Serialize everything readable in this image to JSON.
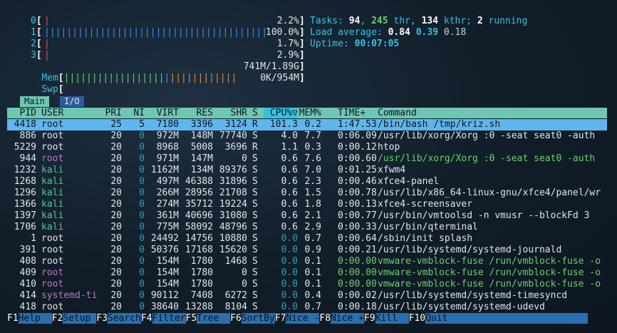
{
  "meters": {
    "cpu": [
      {
        "label": "0",
        "pct": "2.2%",
        "fill": 0.02
      },
      {
        "label": "1",
        "pct": "100.0%",
        "fill": 1.0
      },
      {
        "label": "2",
        "pct": "1.7%",
        "fill": 0.017
      },
      {
        "label": "3",
        "pct": "2.9%",
        "fill": 0.03
      }
    ],
    "mem": {
      "label": "Mem",
      "value": "741M/1.89G",
      "used_fill": 0.4
    },
    "swp": {
      "label": "Swp",
      "value": "0K/954M",
      "fill": 0.0
    }
  },
  "summary": {
    "tasks_label": "Tasks: ",
    "tasks": "94",
    "thr": "245",
    "thr_label": " thr, ",
    "kthr": "134",
    "kthr_label": " kthr; ",
    "running": "2",
    "running_label": " running",
    "load_label": "Load average: ",
    "load1": "0.84",
    "load5": "0.39",
    "load15": "0.18",
    "uptime_label": "Uptime: ",
    "uptime": "00:07:05"
  },
  "tabs": [
    {
      "label": "Main"
    },
    {
      "label": "I/O"
    }
  ],
  "columns": {
    "pid": "PID",
    "user": "USER",
    "pri": "PRI",
    "ni": "NI",
    "virt": "VIRT",
    "res": "RES",
    "shr": "SHR",
    "s": "S",
    "cpu": "CPU%▽",
    "mem": "MEM%",
    "time": "TIME+",
    "cmd": "Command"
  },
  "rows": [
    {
      "pid": "4418",
      "user": "root",
      "pri": "25",
      "ni": "5",
      "virt": "7180",
      "res": "3396",
      "shr": "3124",
      "s": "R",
      "cpu": "101.3",
      "mem": "0.2",
      "time": "1:47.53",
      "cmd": "/bin/bash /tmp/kriz.sh"
    },
    {
      "pid": "886",
      "user": "root",
      "pri": "20",
      "ni": "0",
      "virt": "972M",
      "res": "148M",
      "shr": "77740",
      "s": "S",
      "cpu": "4.0",
      "mem": "7.7",
      "time": "0:06.09",
      "cmd": "/usr/lib/xorg/Xorg :0 -seat seat0 -auth"
    },
    {
      "pid": "5229",
      "user": "root",
      "pri": "20",
      "ni": "0",
      "virt": "8968",
      "res": "5008",
      "shr": "3696",
      "s": "R",
      "cpu": "1.1",
      "mem": "0.3",
      "time": "0:00.12",
      "cmd": "htop"
    },
    {
      "pid": "944",
      "user": "root",
      "pri": "20",
      "ni": "0",
      "virt": "971M",
      "res": "147M",
      "shr": "0",
      "s": "S",
      "cpu": "0.6",
      "mem": "7.6",
      "time": "0:00.60",
      "cmd": "/usr/lib/xorg/Xorg :0 -seat seat0 -auth"
    },
    {
      "pid": "1232",
      "user": "kali",
      "pri": "20",
      "ni": "0",
      "virt": "1162M",
      "res": "134M",
      "shr": "89376",
      "s": "S",
      "cpu": "0.6",
      "mem": "7.0",
      "time": "0:01.25",
      "cmd": "xfwm4"
    },
    {
      "pid": "1268",
      "user": "kali",
      "pri": "20",
      "ni": "0",
      "virt": "497M",
      "res": "46388",
      "shr": "31896",
      "s": "S",
      "cpu": "0.6",
      "mem": "2.3",
      "time": "0:00.46",
      "cmd": "xfce4-panel"
    },
    {
      "pid": "1296",
      "user": "kali",
      "pri": "20",
      "ni": "0",
      "virt": "266M",
      "res": "28956",
      "shr": "21708",
      "s": "S",
      "cpu": "0.6",
      "mem": "1.5",
      "time": "0:00.78",
      "cmd": "/usr/lib/x86_64-linux-gnu/xfce4/panel/wr"
    },
    {
      "pid": "1366",
      "user": "kali",
      "pri": "20",
      "ni": "0",
      "virt": "274M",
      "res": "35712",
      "shr": "19224",
      "s": "S",
      "cpu": "0.6",
      "mem": "1.8",
      "time": "0:00.13",
      "cmd": "xfce4-screensaver"
    },
    {
      "pid": "1397",
      "user": "kali",
      "pri": "20",
      "ni": "0",
      "virt": "361M",
      "res": "40696",
      "shr": "31080",
      "s": "S",
      "cpu": "0.6",
      "mem": "2.1",
      "time": "0:00.77",
      "cmd": "/usr/bin/vmtoolsd -n vmusr --blockFd 3"
    },
    {
      "pid": "1706",
      "user": "kali",
      "pri": "20",
      "ni": "0",
      "virt": "775M",
      "res": "58092",
      "shr": "48796",
      "s": "S",
      "cpu": "0.6",
      "mem": "2.9",
      "time": "0:00.33",
      "cmd": "/usr/bin/qterminal"
    },
    {
      "pid": "1",
      "user": "root",
      "pri": "20",
      "ni": "0",
      "virt": "24492",
      "res": "14756",
      "shr": "10880",
      "s": "S",
      "cpu": "0.0",
      "mem": "0.7",
      "time": "0:00.64",
      "cmd": "/sbin/init splash"
    },
    {
      "pid": "391",
      "user": "root",
      "pri": "20",
      "ni": "0",
      "virt": "50376",
      "res": "17168",
      "shr": "15620",
      "s": "S",
      "cpu": "0.0",
      "mem": "0.9",
      "time": "0:00.21",
      "cmd": "/usr/lib/systemd/systemd-journald"
    },
    {
      "pid": "408",
      "user": "root",
      "pri": "20",
      "ni": "0",
      "virt": "154M",
      "res": "1780",
      "shr": "1468",
      "s": "S",
      "cpu": "0.0",
      "mem": "0.1",
      "time": "0:00.00",
      "cmd": "vmware-vmblock-fuse /run/vmblock-fuse -o"
    },
    {
      "pid": "409",
      "user": "root",
      "pri": "20",
      "ni": "0",
      "virt": "154M",
      "res": "1780",
      "shr": "0",
      "s": "S",
      "cpu": "0.0",
      "mem": "0.1",
      "time": "0:00.00",
      "cmd": "vmware-vmblock-fuse /run/vmblock-fuse -o"
    },
    {
      "pid": "410",
      "user": "root",
      "pri": "20",
      "ni": "0",
      "virt": "154M",
      "res": "1780",
      "shr": "0",
      "s": "S",
      "cpu": "0.0",
      "mem": "0.1",
      "time": "0:00.00",
      "cmd": "vmware-vmblock-fuse /run/vmblock-fuse -o"
    },
    {
      "pid": "414",
      "user": "systemd-ti",
      "pri": "20",
      "ni": "0",
      "virt": "90112",
      "res": "7408",
      "shr": "6272",
      "s": "S",
      "cpu": "0.0",
      "mem": "0.4",
      "time": "0:00.02",
      "cmd": "/usr/lib/systemd/systemd-timesyncd"
    },
    {
      "pid": "418",
      "user": "root",
      "pri": "20",
      "ni": "0",
      "virt": "38640",
      "res": "13288",
      "shr": "8104",
      "s": "S",
      "cpu": "0.0",
      "mem": "0.7",
      "time": "0:00.18",
      "cmd": "/usr/lib/systemd/systemd-udevd"
    }
  ],
  "footer": [
    {
      "key": "F1",
      "action": "Help  "
    },
    {
      "key": "F2",
      "action": "Setup "
    },
    {
      "key": "F3",
      "action": "Search"
    },
    {
      "key": "F4",
      "action": "Filter"
    },
    {
      "key": "F5",
      "action": "Tree  "
    },
    {
      "key": "F6",
      "action": "SortBy"
    },
    {
      "key": "F7",
      "action": "Nice -"
    },
    {
      "key": "F8",
      "action": "Nice +"
    },
    {
      "key": "F9",
      "action": "Kill  "
    },
    {
      "key": "F10",
      "action": "Quit"
    }
  ]
}
